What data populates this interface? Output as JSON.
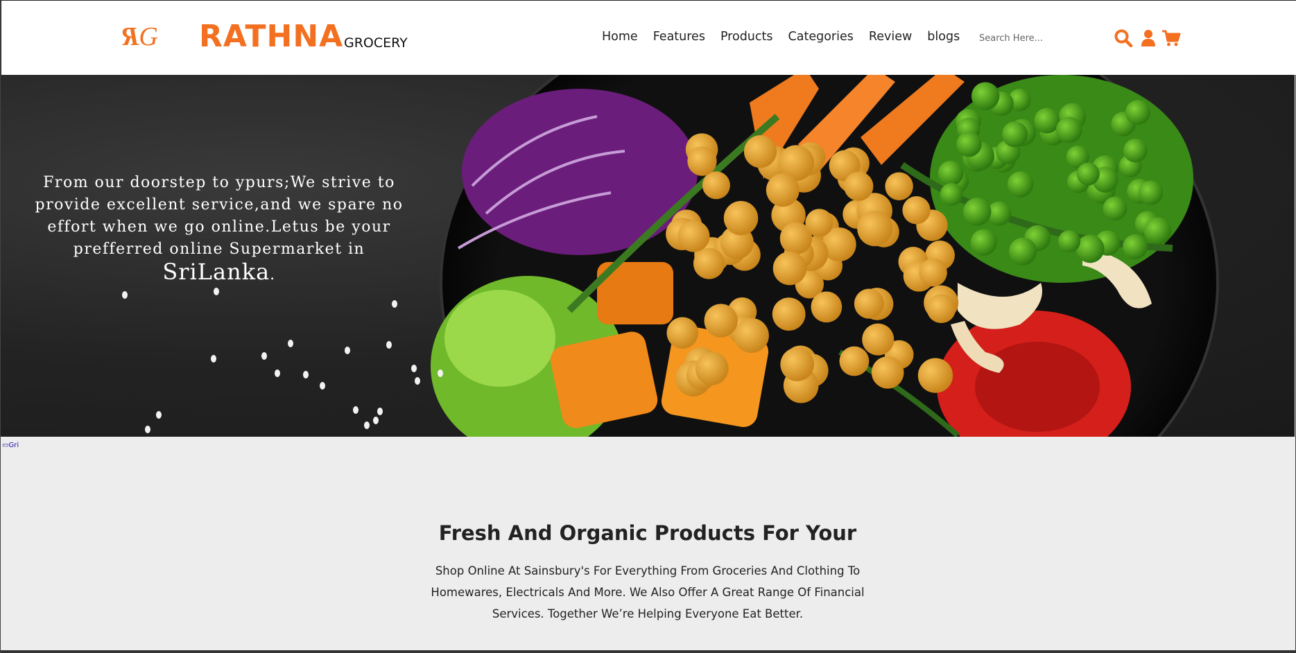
{
  "header": {
    "logo_letters": "RG",
    "brand": "RATHNA",
    "brand_sub": "GROCERY",
    "nav": [
      "Home",
      "Features",
      "Products",
      "Categories",
      "Review",
      "blogs"
    ],
    "search_placeholder": "Search Here...",
    "icons": [
      "search-icon",
      "user-icon",
      "cart-icon"
    ],
    "accent_color": "#f37021"
  },
  "hero": {
    "line1": "From our doorstep to ypurs;We strive to",
    "line2": "provide excellent service,and we spare no",
    "line3": "effort when we go online.Letus be your",
    "line4_prefix": "prefferred online Supermarket in ",
    "line4_big": "SriLanka",
    "line4_suffix": "."
  },
  "broken_image_alt": "Gri",
  "about": {
    "title": "Fresh And Organic Products For Your",
    "text": "Shop Online At Sainsbury's For Everything From Groceries And Clothing To Homewares, Electricals And More. We Also Offer A Great Range Of Financial Services. Together We’re Helping Everyone Eat Better."
  }
}
